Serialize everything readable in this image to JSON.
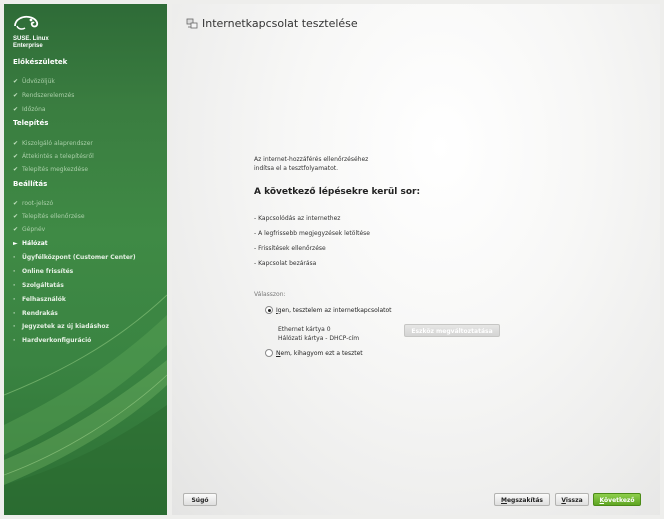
{
  "sidebar": {
    "logo_text_line1": "SUSE. Linux",
    "logo_text_line2": "Enterprise",
    "sections": [
      {
        "title": "Előkészületek"
      },
      {
        "title": "Telepítés"
      },
      {
        "title": "Beállítás"
      }
    ],
    "prep_steps": [
      "Üdvözöljük",
      "Rendszerelemzés",
      "Időzóna"
    ],
    "install_steps": [
      "Kiszolgáló alaprendszer",
      "Áttekintés a telepítésről",
      "Telepítés megkezdése"
    ],
    "config_steps": [
      {
        "label": "root-jelszó",
        "state": "done"
      },
      {
        "label": "Telepítés ellenőrzése",
        "state": "done"
      },
      {
        "label": "Gépnév",
        "state": "done"
      },
      {
        "label": "Hálózat",
        "state": "active"
      },
      {
        "label": "Ügyfélközpont (Customer Center)",
        "state": "todo"
      },
      {
        "label": "Online frissítés",
        "state": "todo"
      },
      {
        "label": "Szolgáltatás",
        "state": "todo"
      },
      {
        "label": "Felhasználók",
        "state": "todo"
      },
      {
        "label": "Rendrakás",
        "state": "todo"
      },
      {
        "label": "Jegyzetek az új kiadáshoz",
        "state": "todo"
      },
      {
        "label": "Hardverkonfiguráció",
        "state": "todo"
      }
    ],
    "check_mark": "✔",
    "arrow_mark": "►",
    "dot_mark": "·"
  },
  "main": {
    "title": "Internetkapcsolat tesztelése",
    "intro_line1": "Az internet-hozzáférés ellenőrzéséhez",
    "intro_line2": "indítsa el a tesztfolyamatot.",
    "steps_heading": "A következő lépésekre kerül sor:",
    "steps": [
      "- Kapcsolódás az internethez",
      "- A legfrissebb megjegyzések letöltése",
      "- Frissítések ellenőrzése",
      "- Kapcsolat bezárása"
    ],
    "choose_label": "Válasszon:",
    "option_yes_u": "I",
    "option_yes_rest": "gen, tesztelem az internetkapcsolatot",
    "option_no_u": "N",
    "option_no_rest": "em, kihagyom ezt a tesztet",
    "iface_line1": "Ethernet kártya 0",
    "iface_line2": "Hálózati kártya - DHCP-cím",
    "change_device_button": "Eszköz megváltoztatása"
  },
  "buttons": {
    "help": "Súgó",
    "abort_u": "M",
    "abort_rest": "egszakítás",
    "back_u": "V",
    "back_rest": "issza",
    "next_u": "K",
    "next_rest": "övetkező"
  },
  "colors": {
    "sidebar_green": "#3f8a45",
    "next_button": "#5fa523"
  }
}
